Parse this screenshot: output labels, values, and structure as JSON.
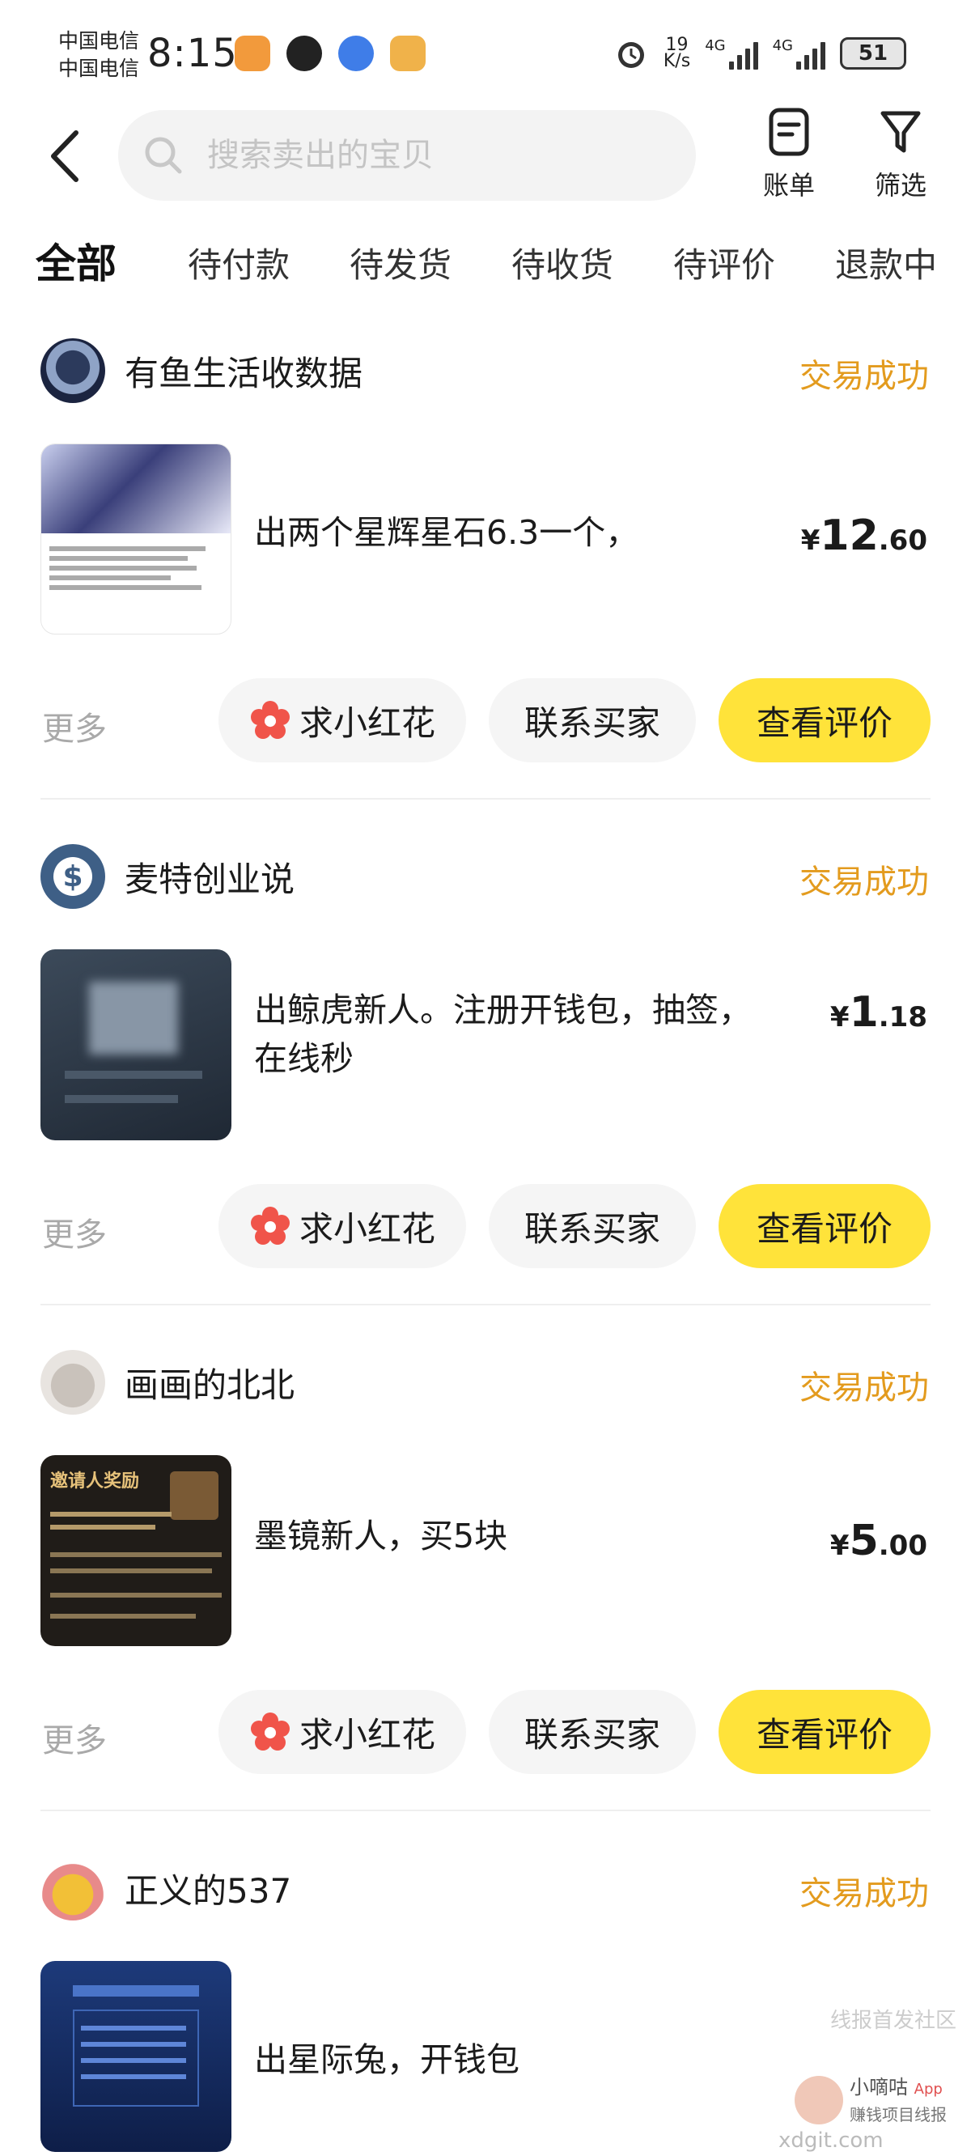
{
  "status_bar": {
    "carrier_1": "中国电信",
    "carrier_2": "中国电信",
    "time": "8:15",
    "net_speed_value": "19",
    "net_speed_unit": "K/s",
    "signal_1": "4G",
    "signal_2": "4G",
    "battery": "51"
  },
  "header": {
    "search_placeholder": "搜索卖出的宝贝",
    "bill_label": "账单",
    "filter_label": "筛选"
  },
  "tabs": [
    "全部",
    "待付款",
    "待发货",
    "待收货",
    "待评价",
    "退款中"
  ],
  "active_tab": "全部",
  "orders": [
    {
      "seller": "有鱼生活收数据",
      "status": "交易成功",
      "title": "出两个星辉星石6.3一个，",
      "price_currency": "¥",
      "price_int": "12",
      "price_dec": ".60",
      "more": "更多",
      "flower_btn": "求小红花",
      "contact_btn": "联系买家",
      "review_btn": "查看评价"
    },
    {
      "seller": "麦特创业说",
      "status": "交易成功",
      "title": "出鲸虎新人。注册开钱包，抽签，在线秒",
      "price_currency": "¥",
      "price_int": "1",
      "price_dec": ".18",
      "more": "更多",
      "flower_btn": "求小红花",
      "contact_btn": "联系买家",
      "review_btn": "查看评价"
    },
    {
      "seller": "画画的北北",
      "status": "交易成功",
      "title": "墨镜新人，买5块",
      "price_currency": "¥",
      "price_int": "5",
      "price_dec": ".00",
      "more": "更多",
      "flower_btn": "求小红花",
      "contact_btn": "联系买家",
      "review_btn": "查看评价"
    },
    {
      "seller": "正义的537",
      "status": "交易成功",
      "title": "出星际兔，开钱包"
    }
  ],
  "thumbnail_text": {
    "order3_heading": "邀请人奖励"
  },
  "watermark": {
    "line1": "线报首发社区",
    "name": "小嘀咕",
    "tag": "App",
    "slogan": "赚钱项目线报",
    "site": "xdgit.com"
  },
  "colors": {
    "accent_yellow": "#ffe33a",
    "status_orange": "#e39b1e",
    "muted_gray": "#a9a9a9",
    "button_gray": "#f5f5f5"
  }
}
